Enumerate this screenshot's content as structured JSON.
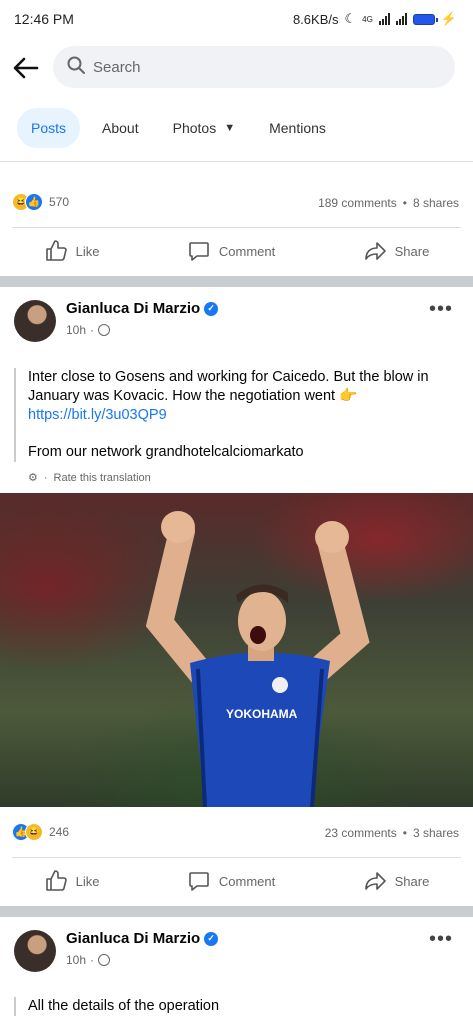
{
  "status_bar": {
    "time": "12:46 PM",
    "speed": "8.6KB/s",
    "network": "4G",
    "battery": "78"
  },
  "search": {
    "placeholder": "Search"
  },
  "tabs": [
    {
      "label": "Posts",
      "active": true
    },
    {
      "label": "About",
      "active": false
    },
    {
      "label": "Photos",
      "active": false
    },
    {
      "label": "Mentions",
      "active": false
    }
  ],
  "post_prev": {
    "reaction_count": "570",
    "comments": "189 comments",
    "shares": "8 shares"
  },
  "actions": {
    "like": "Like",
    "comment": "Comment",
    "share": "Share"
  },
  "post1": {
    "author": "Gianluca Di Marzio",
    "time": "10h",
    "text": "Inter close to Gosens and working for Caicedo. But the blow in January was Kovacic. How the negotiation went 👉",
    "link": "https://bit.ly/3u03QP9",
    "footer_text": "From our network grandhotelcalciomarkato",
    "translate_label": "Rate this translation",
    "reaction_count": "246",
    "comments": "23 comments",
    "shares": "3 shares"
  },
  "post2": {
    "author": "Gianluca Di Marzio",
    "time": "10h",
    "text": "All the details of the operation"
  },
  "colors": {
    "accent": "#1877f2",
    "muted": "#65676b",
    "tab_active_bg": "#e7f3ff"
  }
}
